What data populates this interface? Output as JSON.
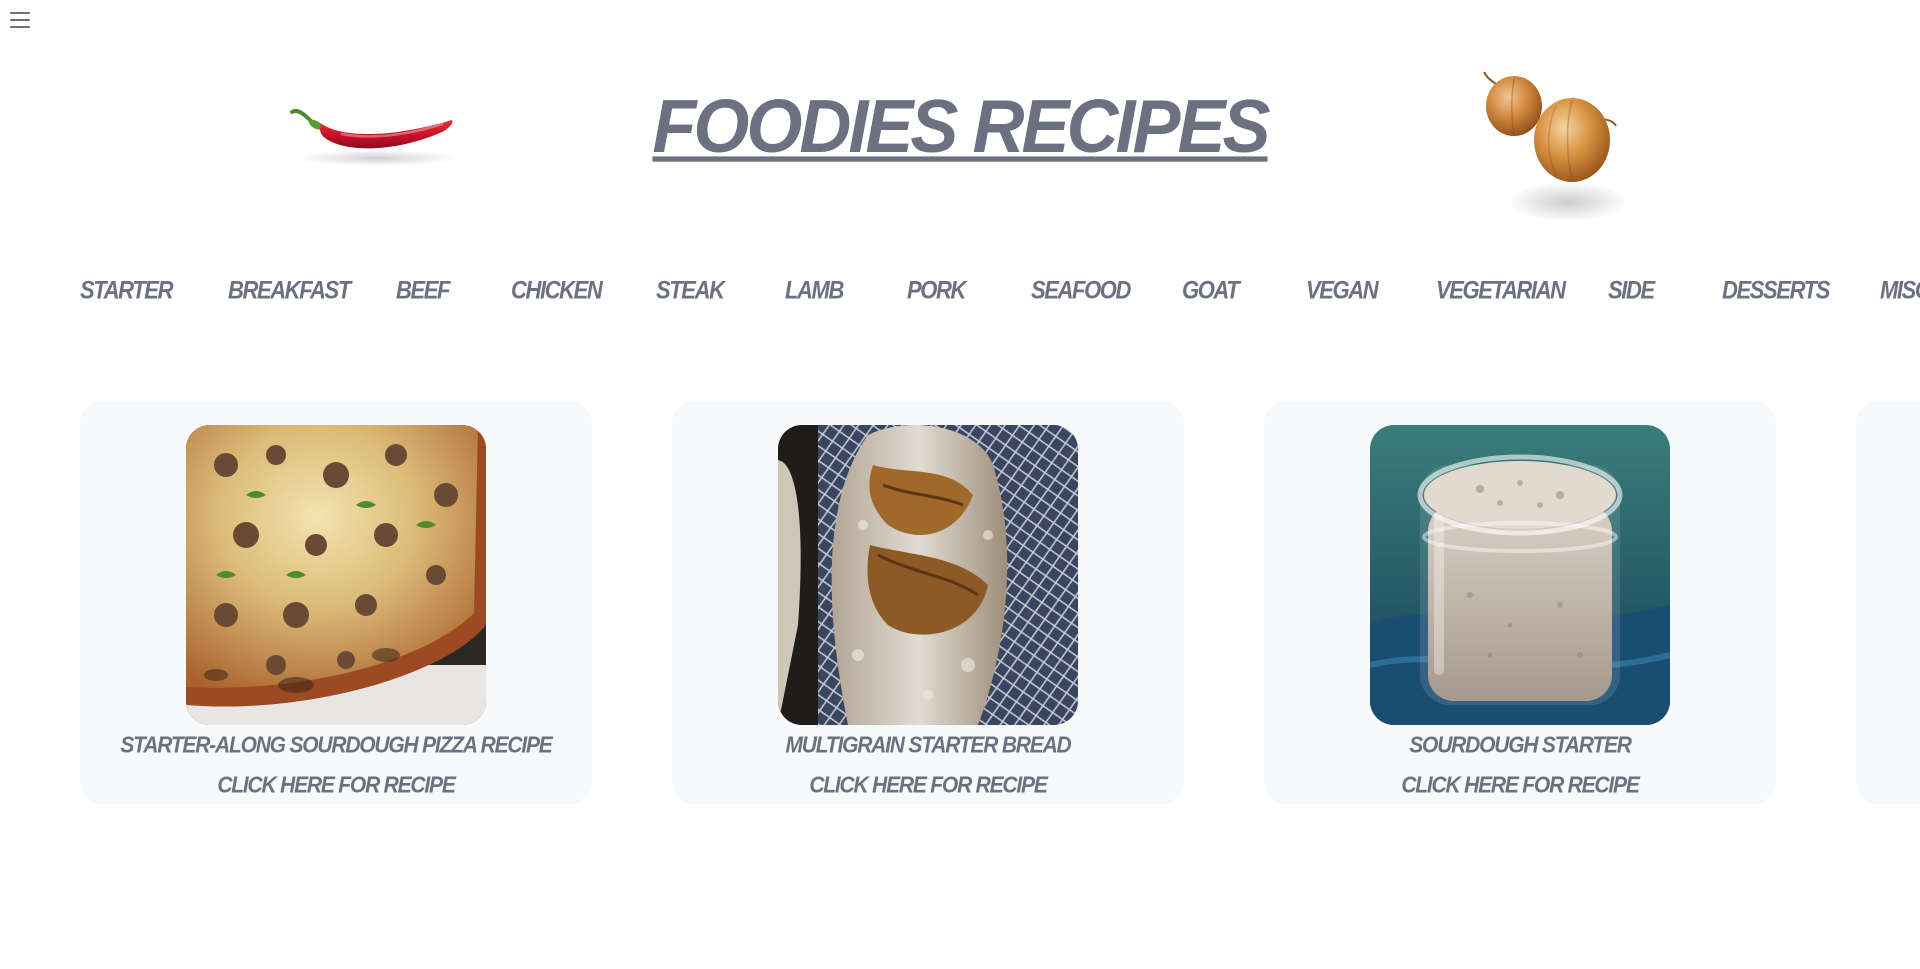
{
  "header": {
    "menu_icon": "hamburger-menu-icon",
    "title": "FOODIES RECIPES",
    "decor_left": "chili-pepper-image",
    "decor_right": "onions-image"
  },
  "categories": [
    "STARTER",
    "BREAKFAST",
    "BEEF",
    "CHICKEN",
    "STEAK",
    "LAMB",
    "PORK",
    "SEAFOOD",
    "GOAT",
    "VEGAN",
    "VEGETARIAN",
    "SIDE",
    "DESSERTS",
    "MISC"
  ],
  "recipes": [
    {
      "title": "STARTER-ALONG SOURDOUGH PIZZA RECIPE",
      "link": "CLICK HERE FOR RECIPE",
      "image": "sourdough-pizza-image"
    },
    {
      "title": "MULTIGRAIN STARTER BREAD",
      "link": "CLICK HERE FOR RECIPE",
      "image": "multigrain-bread-image"
    },
    {
      "title": "SOURDOUGH STARTER",
      "link": "CLICK HERE FOR RECIPE",
      "image": "sourdough-starter-jar-image"
    }
  ],
  "colors": {
    "text": "#6b7180",
    "card_background": "#f8f9fb",
    "page_background": "#ffffff"
  }
}
